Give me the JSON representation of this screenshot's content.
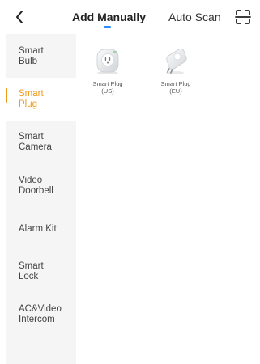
{
  "header": {
    "back_icon": "chevron-left-icon",
    "tabs": [
      {
        "label": "Add Manually",
        "active": true
      },
      {
        "label": "Auto Scan",
        "active": false
      }
    ],
    "scan_icon": "scan-frame-icon",
    "indicator_color": "#2f8cff"
  },
  "sidebar": {
    "active_color": "#f09a1a",
    "items": [
      {
        "line1": "Smart",
        "line2": "Bulb",
        "active": false
      },
      {
        "line1": "Smart",
        "line2": "Plug",
        "active": true
      },
      {
        "line1": "Smart",
        "line2": "Camera",
        "active": false
      },
      {
        "line1": "Video",
        "line2": "Doorbell",
        "active": false
      },
      {
        "line1": "Alarm Kit",
        "line2": "",
        "active": false
      },
      {
        "line1": "Smart",
        "line2": "Lock",
        "active": false
      },
      {
        "line1": "AC&Video",
        "line2": "Intercom",
        "active": false
      }
    ]
  },
  "products": [
    {
      "name_line1": "Smart Plug",
      "name_line2": "(US)",
      "icon": "smart-plug-us-icon"
    },
    {
      "name_line1": "Smart Plug",
      "name_line2": "(EU)",
      "icon": "smart-plug-eu-icon"
    }
  ]
}
